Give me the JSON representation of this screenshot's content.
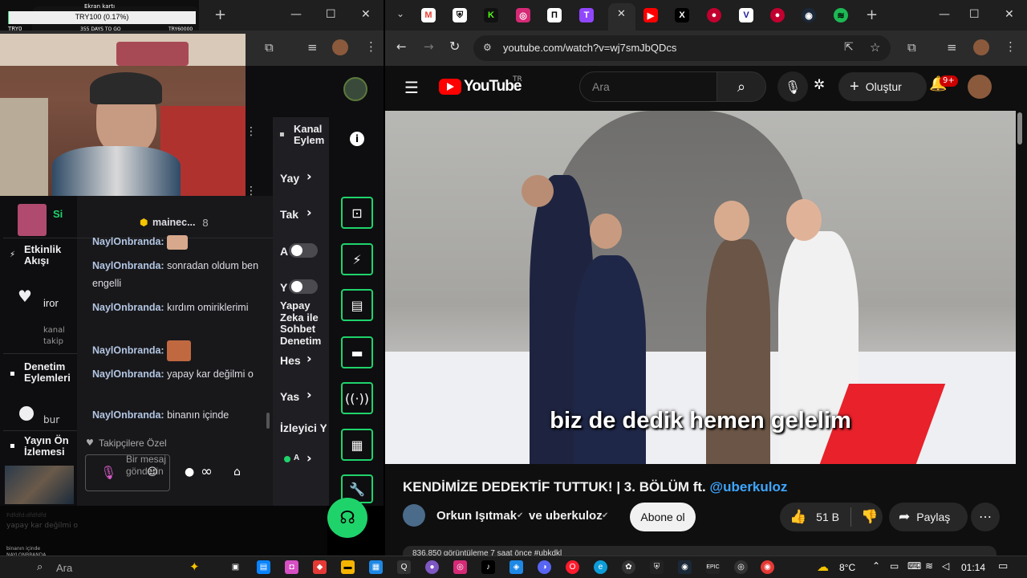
{
  "colors": {
    "accent_green": "#1fd36b",
    "twitch_purple": "#9147ff",
    "yt_red": "#ff0000",
    "mention_blue": "#3ea6ff",
    "chat_user": "#b3c6e3"
  },
  "overlay": {
    "title": "Ekran kartı",
    "progress_text": "TRY100 (0.17%)",
    "progress_fraction": 0.0017,
    "left_label": "TRY0",
    "mid_label": "355 DAYS TO GO",
    "right_label": "TRY60000"
  },
  "left_browser": {
    "chat": {
      "pinned_user": "mainec...",
      "pinned_count": "8",
      "messages": [
        {
          "user": "NaylOnbranda:",
          "text": "",
          "emote": "emote-face"
        },
        {
          "user": "NaylOnbranda:",
          "text": "sonradan oldum ben engelli"
        },
        {
          "user": "NaylOnbranda:",
          "text": "kırdım omiriklerimi"
        },
        {
          "user": "NaylOnbranda:",
          "text": "",
          "emote": "emote-face"
        },
        {
          "user": "NaylOnbranda:",
          "text": "yapay kar değilmi o"
        },
        {
          "user": "NaylOnbranda:",
          "text": "binanın içinde"
        }
      ],
      "followers_only": "Takipçilere Özel",
      "input_placeholder": "Bir mesaj gönderin",
      "infinity": "∞"
    },
    "left_nav": {
      "streamer_initial": "Si",
      "activity_title": "Etkinlik Akışı",
      "activity_user": "iror",
      "activity_sub1": "kanal",
      "activity_sub2": "takip",
      "moderation_title": "Denetim Eylemleri",
      "moderation_sub": "bur",
      "preview_title": "Yayın Ön İzlemesi"
    },
    "mod_panel": {
      "title": "Kanal Eylem",
      "rows": [
        "Yay",
        "Tak",
        "A",
        "Y",
        "Yapay Zeka ile Sohbet Denetim",
        "Hes",
        "Yas",
        "İzleyici Y",
        "A"
      ]
    },
    "faded": {
      "line1": "Fdfdfd:dfdfdfd",
      "line2": "yapay kar değilmi o",
      "line3": "NAYLONBRANDA",
      "line4": "binanın içinde"
    }
  },
  "right_browser": {
    "url": "youtube.com/watch?v=wj7smJbQDcs",
    "youtube": {
      "logo": "YouTube",
      "country": "TR",
      "search_placeholder": "Ara",
      "create_label": "Oluştur",
      "notif_badge": "9+",
      "subtitle": "biz de dedik hemen gelelim",
      "video_title": "KENDİMİZE DEDEKTİF TUTTUK! | 3. BÖLÜM ft. ",
      "video_mention": "@uberkuloz",
      "channel_name": "Orkun Işıtmak",
      "and_label": "ve uberkuloz",
      "subscribe_label": "Abone ol",
      "likes": "51 B",
      "share_label": "Paylaş",
      "views_partial": "836.850 görüntüleme  7 saat önce  #ubkdkl"
    }
  },
  "taskbar": {
    "search_placeholder": "Ara",
    "weather": "8°C",
    "time": "01:14"
  }
}
